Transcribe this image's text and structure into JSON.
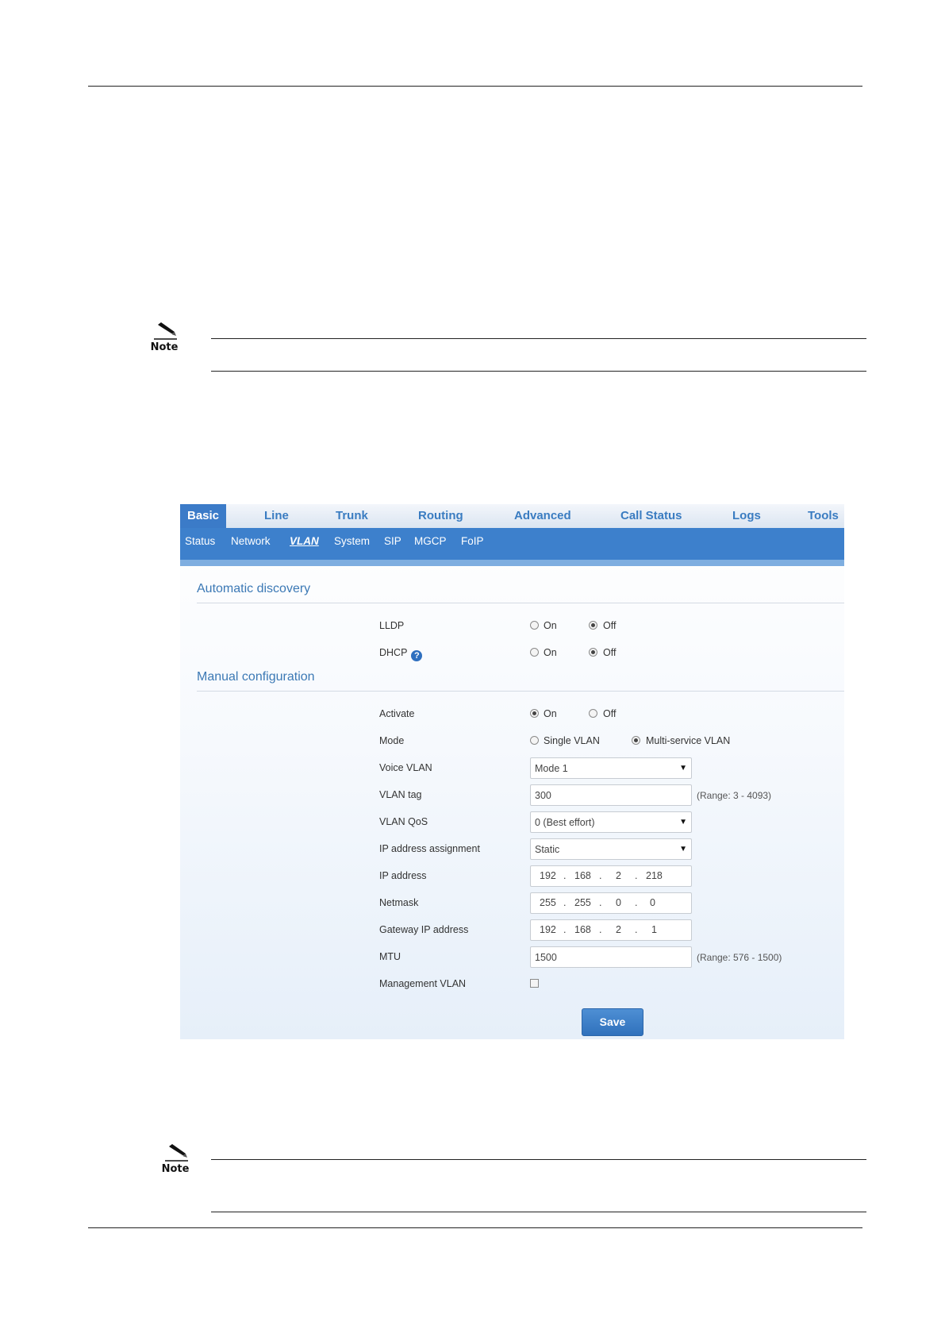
{
  "notes": [
    {
      "label": "Note"
    },
    {
      "label": "Note"
    }
  ],
  "webui": {
    "tabs": [
      "Basic",
      "Line",
      "Trunk",
      "Routing",
      "Advanced",
      "Call Status",
      "Logs",
      "Tools"
    ],
    "active_tab": "Basic",
    "subtabs": [
      "Status",
      "Network",
      "VLAN",
      "System",
      "SIP",
      "MGCP",
      "FoIP"
    ],
    "active_subtab": "VLAN",
    "auto_discovery": {
      "title": "Automatic discovery",
      "lldp": {
        "label": "LLDP",
        "on": "On",
        "off": "Off",
        "selected": "Off"
      },
      "dhcp": {
        "label": "DHCP",
        "help_glyph": "?",
        "on": "On",
        "off": "Off",
        "selected": "Off"
      }
    },
    "manual": {
      "title": "Manual configuration",
      "activate": {
        "label": "Activate",
        "on": "On",
        "off": "Off",
        "selected": "On"
      },
      "mode": {
        "label": "Mode",
        "single": "Single VLAN",
        "multi": "Multi-service VLAN",
        "selected": "Multi-service VLAN"
      },
      "voice_vlan": {
        "label": "Voice VLAN",
        "value": "Mode 1"
      },
      "vlan_tag": {
        "label": "VLAN tag",
        "value": "300",
        "range": "(Range: 3 - 4093)"
      },
      "vlan_qos": {
        "label": "VLAN QoS",
        "value": "0 (Best effort)"
      },
      "ip_assignment": {
        "label": "IP address assignment",
        "value": "Static"
      },
      "ip_address": {
        "label": "IP address",
        "octets": [
          "192",
          "168",
          "2",
          "218"
        ]
      },
      "netmask": {
        "label": "Netmask",
        "octets": [
          "255",
          "255",
          "0",
          "0"
        ]
      },
      "gateway": {
        "label": "Gateway IP address",
        "octets": [
          "192",
          "168",
          "2",
          "1"
        ]
      },
      "mtu": {
        "label": "MTU",
        "value": "1500",
        "range": "(Range: 576 - 1500)"
      },
      "mgmt_vlan": {
        "label": "Management VLAN",
        "checked": false
      }
    },
    "save_label": "Save"
  }
}
